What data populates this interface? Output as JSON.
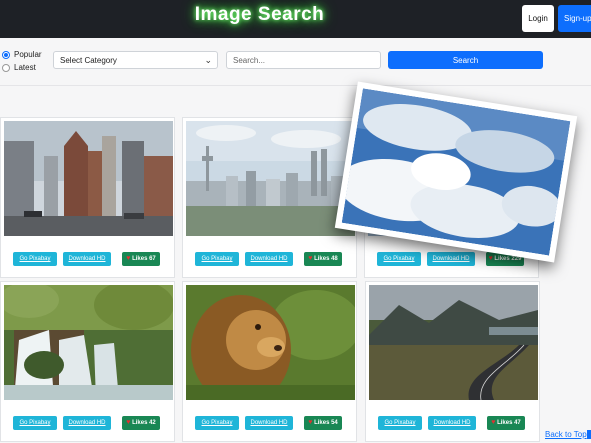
{
  "app": {
    "title": "Image Search"
  },
  "auth": {
    "login_label": "Login",
    "signup_label": "Sign-up"
  },
  "filters": {
    "sort_options": [
      {
        "label": "Popular",
        "selected": true
      },
      {
        "label": "Latest",
        "selected": false
      }
    ],
    "category_selected": "Select Category",
    "search_placeholder": "Search...",
    "search_button": "Search"
  },
  "cards": [
    {
      "scene": "city-flatiron",
      "go_label": "Go Pixabay",
      "download_label": "Download HD",
      "likes_label": "Likes 67"
    },
    {
      "scene": "city-skyline",
      "go_label": "Go Pixabay",
      "download_label": "Download HD",
      "likes_label": "Likes 48"
    },
    {
      "scene": "hidden",
      "go_label": "Go Pixabay",
      "download_label": "Download HD",
      "likes_label": "Likes 229"
    },
    {
      "scene": "waterfall",
      "go_label": "Go Pixabay",
      "download_label": "Download HD",
      "likes_label": "Likes 42"
    },
    {
      "scene": "lion",
      "go_label": "Go Pixabay",
      "download_label": "Download HD",
      "likes_label": "Likes 54"
    },
    {
      "scene": "mountain-road",
      "go_label": "Go Pixabay",
      "download_label": "Download HD",
      "likes_label": "Likes 47"
    }
  ],
  "preview": {
    "scene": "clouds-sky"
  },
  "footer": {
    "back_to_top": "Back to Top"
  },
  "colors": {
    "brand_glow": "#43d943",
    "primary": "#0d6efd",
    "info": "#1fb5d8",
    "success": "#198754",
    "topbar": "#1e2126"
  }
}
